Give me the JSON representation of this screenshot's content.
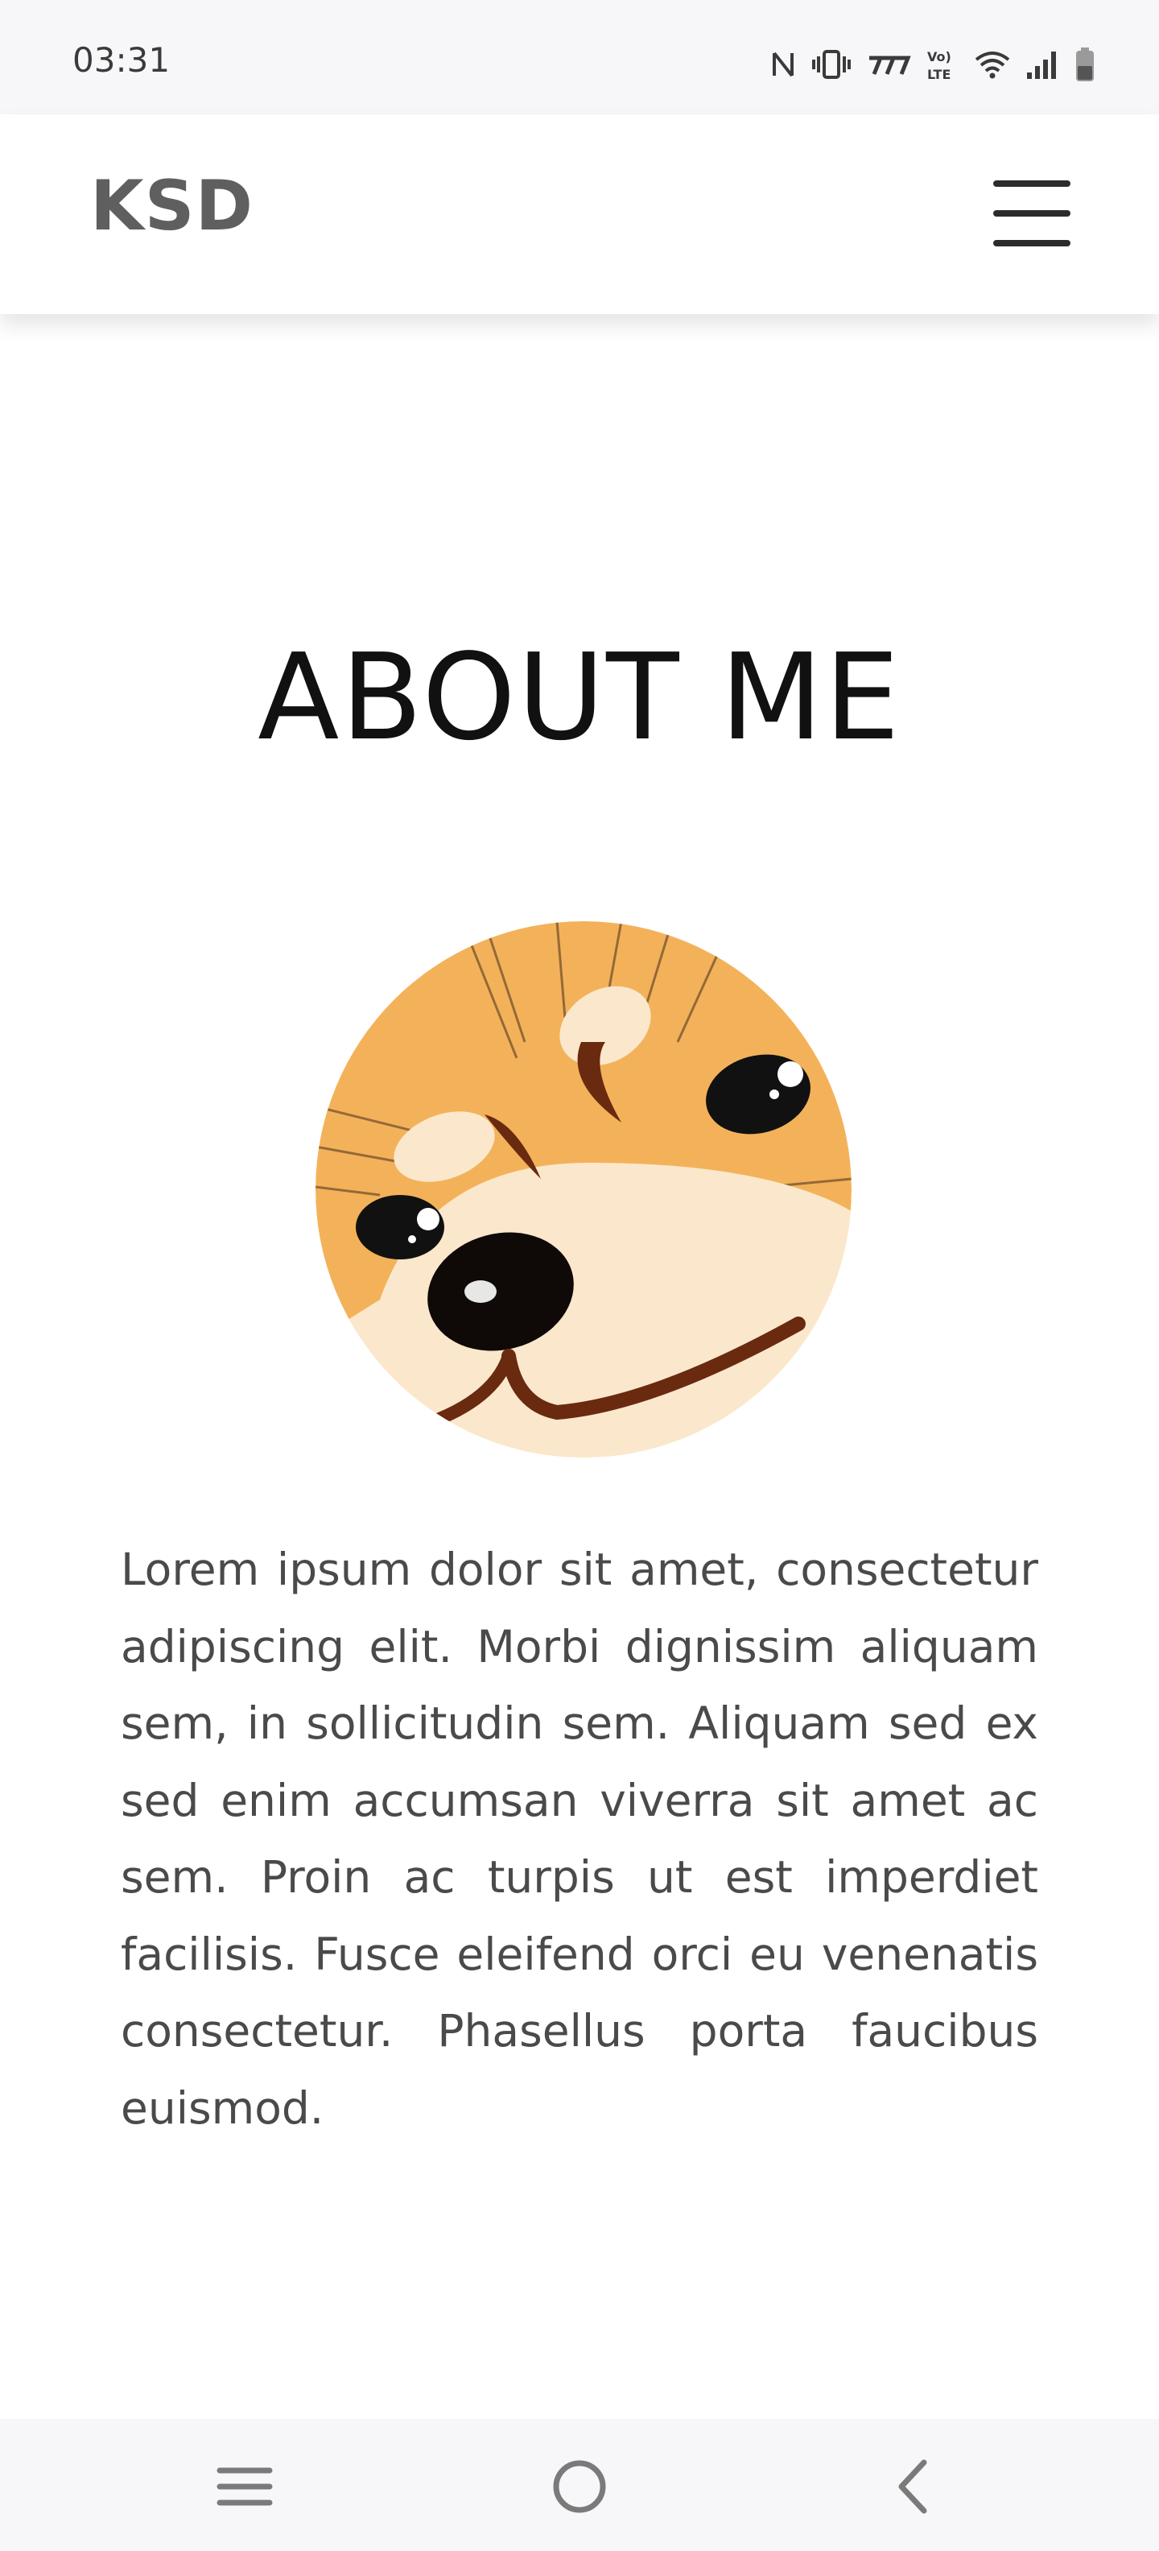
{
  "status_bar": {
    "time": "03:31",
    "icons": [
      "nfc-icon",
      "vibrate-icon",
      "carrier-icon",
      "volte-icon",
      "wifi-icon",
      "signal-icon",
      "battery-icon"
    ]
  },
  "navbar": {
    "brand": "KSD",
    "menu_icon": "hamburger-menu-icon"
  },
  "about": {
    "title": "ABOUT ME",
    "avatar_icon": "shiba-dog-avatar",
    "bio": "Lorem ipsum dolor sit amet, consectetur adipiscing elit. Morbi dignissim aliquam sem, in sollicitudin sem. Aliquam sed ex sed enim accumsan viverra sit amet ac sem. Proin ac turpis ut est imperdiet facilisis. Fusce eleifend orci eu venenatis consectetur. Phasellus porta faucibus euismod."
  },
  "system_nav": {
    "buttons": [
      "recent-apps-icon",
      "home-icon",
      "back-icon"
    ]
  },
  "colors": {
    "status_bg": "#f7f7f9",
    "brand_text": "#5f5f5f",
    "body_text": "#4a4a4a",
    "title_text": "#111111",
    "avatar_orange": "#f3b25a",
    "avatar_cream": "#fbe8cc"
  }
}
